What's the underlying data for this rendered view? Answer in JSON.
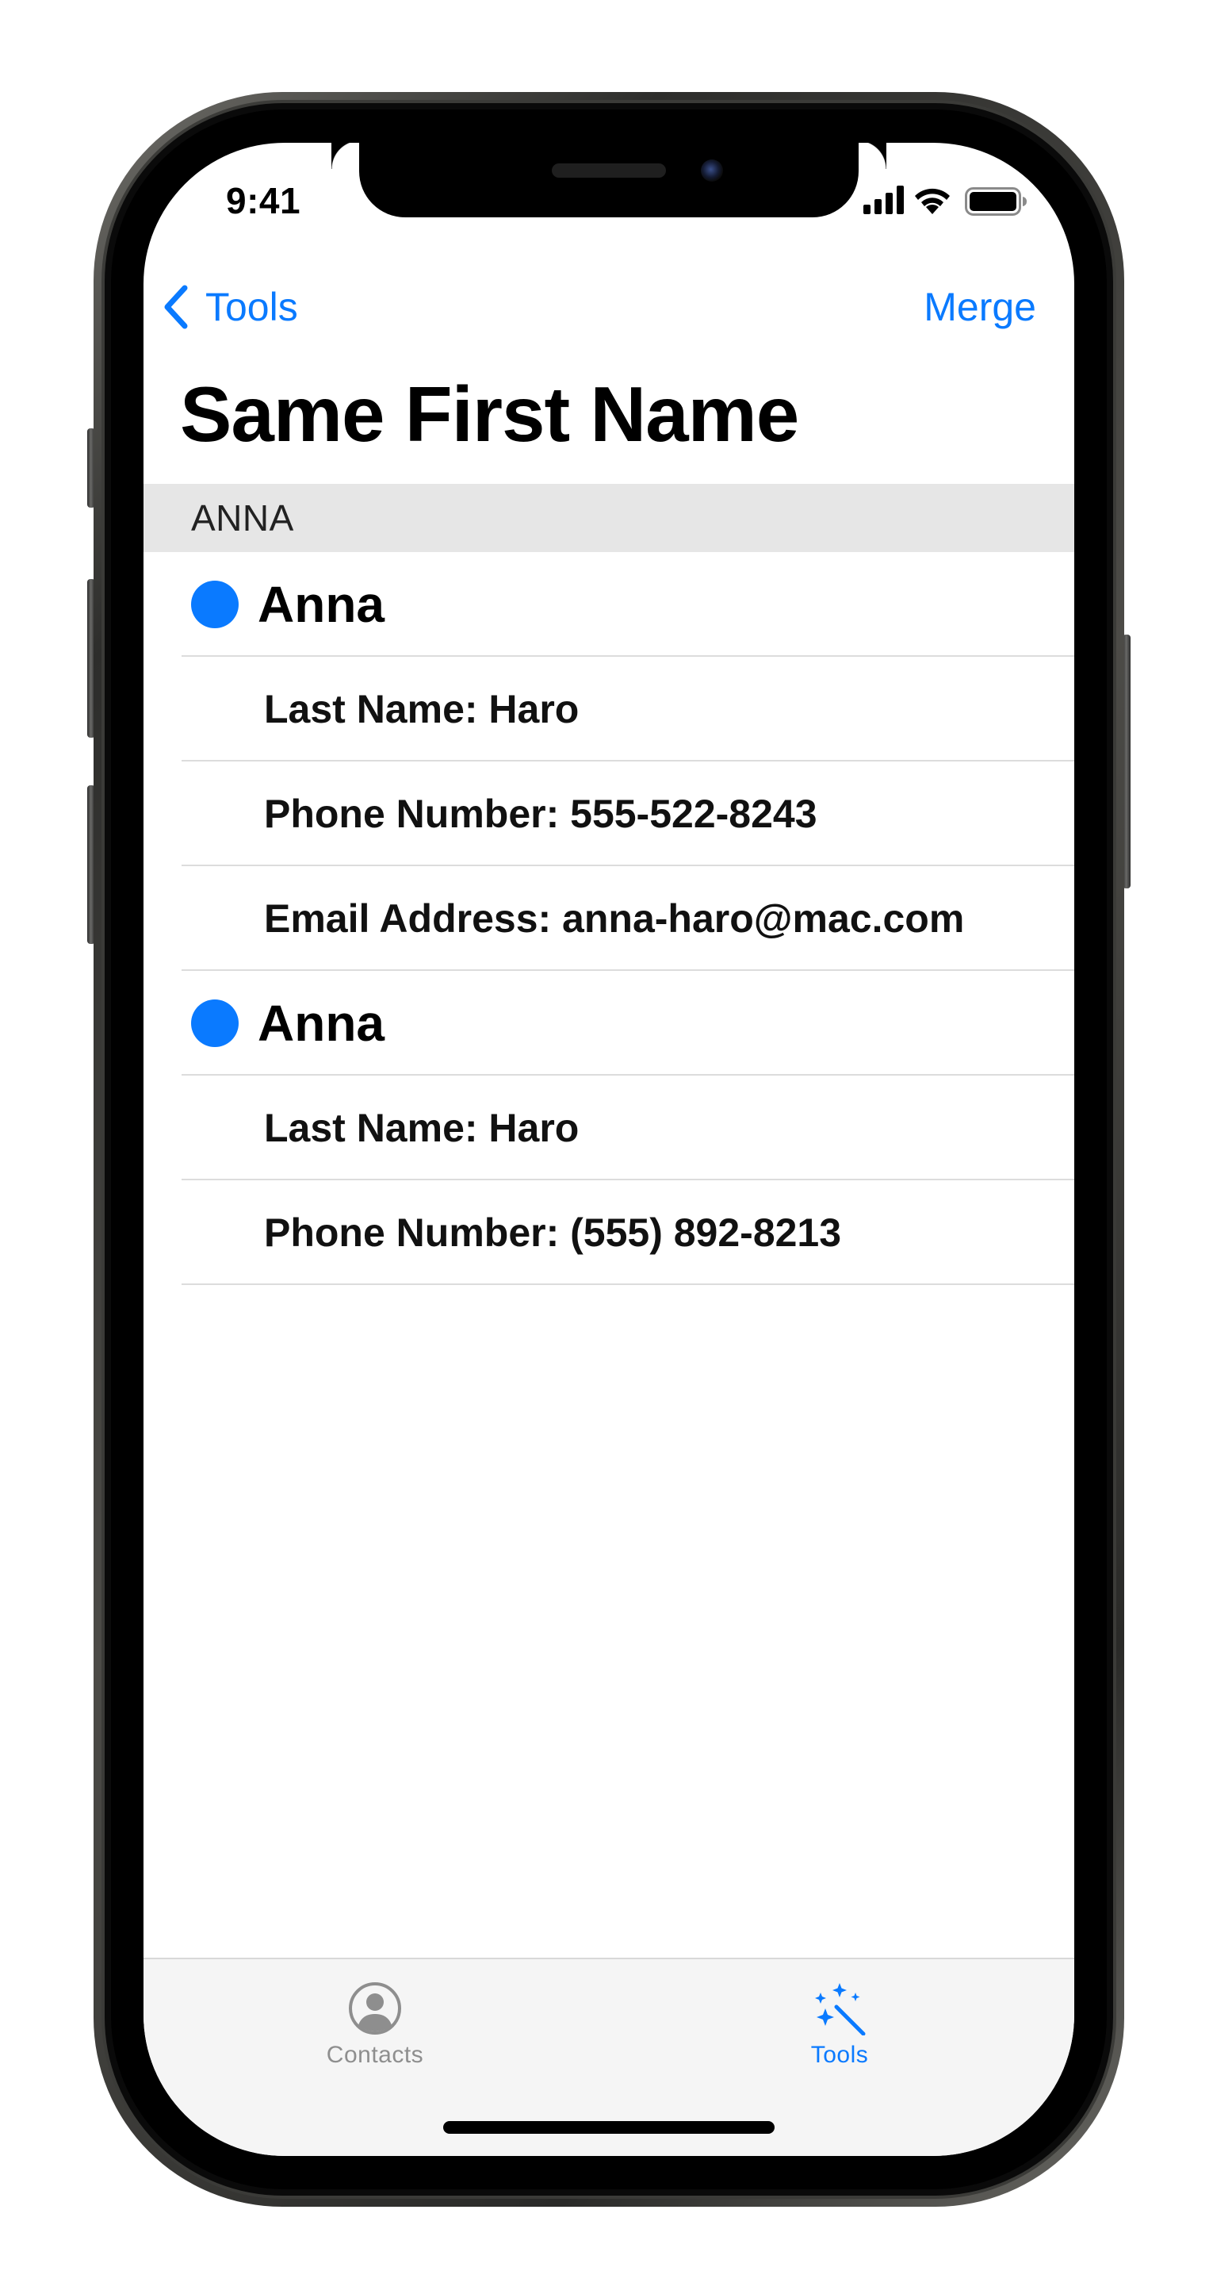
{
  "status_bar": {
    "time": "9:41",
    "icons": [
      "cellular-signal-icon",
      "wifi-icon",
      "battery-icon"
    ]
  },
  "nav": {
    "back_label": "Tools",
    "back_icon": "chevron-left-icon",
    "action_label": "Merge"
  },
  "page": {
    "title": "Same First Name"
  },
  "section": {
    "header": "ANNA",
    "contacts": [
      {
        "name": "Anna",
        "selected": true,
        "details": [
          "Last Name: Haro",
          "Phone Number: 555-522-8243",
          "Email Address: anna-haro@mac.com"
        ]
      },
      {
        "name": "Anna",
        "selected": true,
        "details": [
          "Last Name: Haro",
          "Phone Number: (555) 892-8213"
        ]
      }
    ]
  },
  "tab_bar": {
    "tabs": [
      {
        "label": "Contacts",
        "icon": "person-circle-icon",
        "active": false
      },
      {
        "label": "Tools",
        "icon": "magic-wand-icon",
        "active": true
      }
    ]
  },
  "colors": {
    "accent": "#0a7aff",
    "section_header_bg": "#e6e6e6",
    "tab_bar_bg": "#f5f5f5",
    "inactive_tab": "#8e8e8e"
  }
}
